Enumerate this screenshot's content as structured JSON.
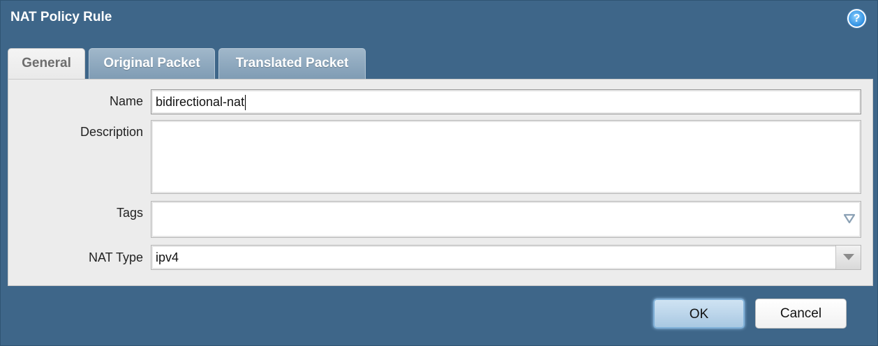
{
  "dialog": {
    "title": "NAT Policy Rule",
    "help_icon": "?"
  },
  "tabs": [
    {
      "label": "General",
      "active": true
    },
    {
      "label": "Original Packet",
      "active": false
    },
    {
      "label": "Translated Packet",
      "active": false
    }
  ],
  "form": {
    "name_label": "Name",
    "name_value": "bidirectional-nat",
    "description_label": "Description",
    "description_value": "",
    "tags_label": "Tags",
    "tags_value": "",
    "nat_type_label": "NAT Type",
    "nat_type_value": "ipv4"
  },
  "buttons": {
    "ok": "OK",
    "cancel": "Cancel"
  },
  "icons": {
    "help": "help-icon",
    "tags_dropdown": "triangle-down-icon",
    "nat_dropdown": "chevron-down-icon"
  },
  "colors": {
    "dialog_bg": "#3e6689",
    "panel_bg": "#ececec",
    "active_tab_text": "#6d6d6d",
    "inactive_tab_bg": "#8ea9bf",
    "ok_button_bg": "#bcd6eb"
  }
}
